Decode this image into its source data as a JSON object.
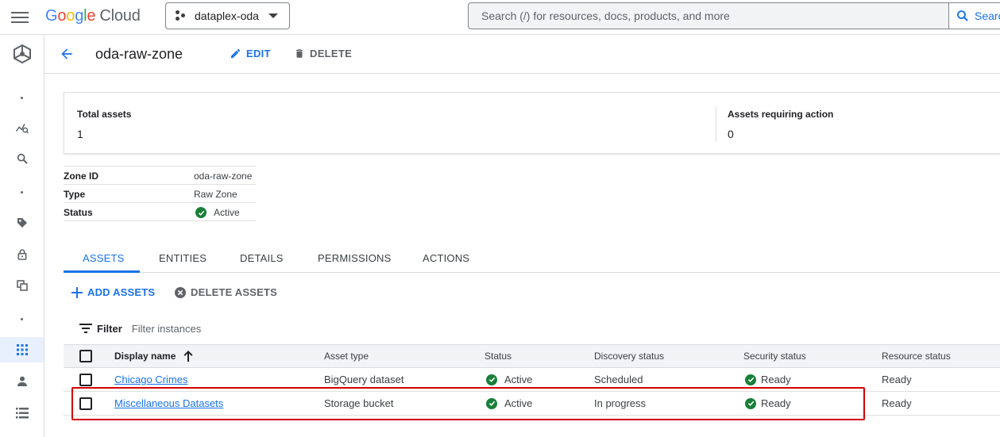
{
  "topbar": {
    "logo_google": "Google",
    "logo_cloud": "Cloud",
    "project": "dataplex-oda",
    "search_placeholder": "Search (/) for resources, docs, products, and more",
    "search_button": "Search"
  },
  "header": {
    "title": "oda-raw-zone",
    "edit_label": "EDIT",
    "delete_label": "DELETE"
  },
  "summary": {
    "total_assets_label": "Total assets",
    "total_assets_value": "1",
    "requiring_action_label": "Assets requiring action",
    "requiring_action_value": "0"
  },
  "details": {
    "zone_id_key": "Zone ID",
    "zone_id_value": "oda-raw-zone",
    "type_key": "Type",
    "type_value": "Raw Zone",
    "status_key": "Status",
    "status_value": "Active"
  },
  "tabs": [
    "ASSETS",
    "ENTITIES",
    "DETAILS",
    "PERMISSIONS",
    "ACTIONS"
  ],
  "actions": {
    "add_assets": "ADD ASSETS",
    "delete_assets": "DELETE ASSETS"
  },
  "filter": {
    "label": "Filter",
    "placeholder": "Filter instances"
  },
  "table": {
    "columns": [
      "Display name",
      "Asset type",
      "Status",
      "Discovery status",
      "Security status",
      "Resource status"
    ],
    "rows": [
      {
        "name": "Chicago Crimes",
        "asset_type": "BigQuery dataset",
        "status": "Active",
        "discovery": "Scheduled",
        "security": "Ready",
        "resource": "Ready"
      },
      {
        "name": "Miscellaneous Datasets",
        "asset_type": "Storage bucket",
        "status": "Active",
        "discovery": "In progress",
        "security": "Ready",
        "resource": "Ready"
      }
    ]
  },
  "colors": {
    "accent": "#1a73e8",
    "success": "#188038",
    "highlight": "#d50000"
  }
}
